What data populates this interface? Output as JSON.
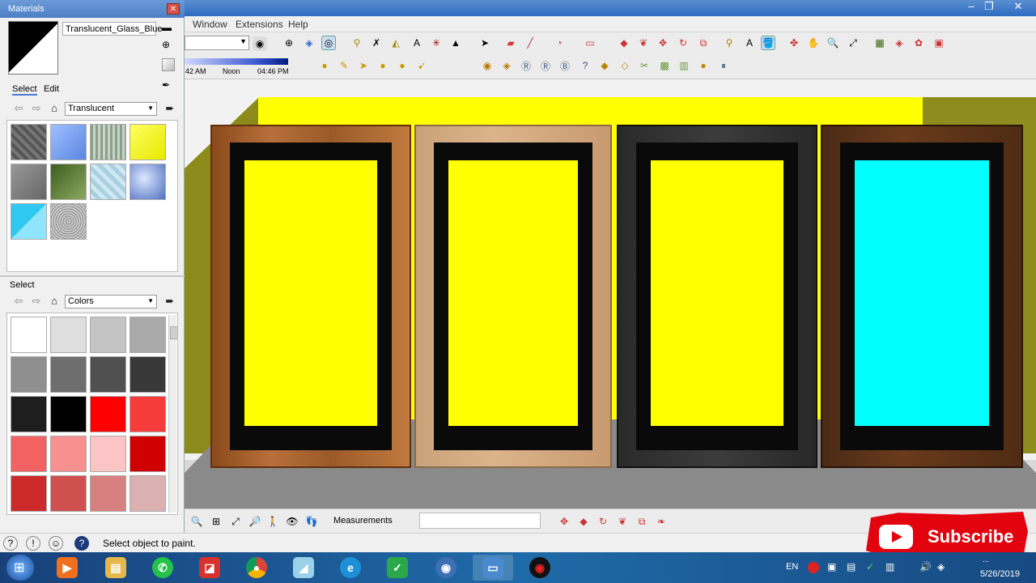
{
  "app": {
    "menu": [
      "Window",
      "Extensions",
      "Help"
    ],
    "shadow_times": {
      "left": "42 AM",
      "mid": "Noon",
      "right": "04:46 PM"
    }
  },
  "materials": {
    "title": "Materials",
    "current_material": "Translucent_Glass_Blue",
    "tabs": [
      "Select",
      "Edit"
    ],
    "library_top": "Translucent",
    "select_label": "Select",
    "library_bottom": "Colors"
  },
  "measurements_label": "Measurements",
  "status_text": "Select object to paint.",
  "subscribe_label": "Subscribe",
  "taskbar": {
    "lang": "EN",
    "time": "...",
    "date": "5/26/2019"
  },
  "colors": {
    "wall_yellow": "#ffff00",
    "glass_cyan": "#00ffff",
    "accent_red": "#e2030f"
  }
}
